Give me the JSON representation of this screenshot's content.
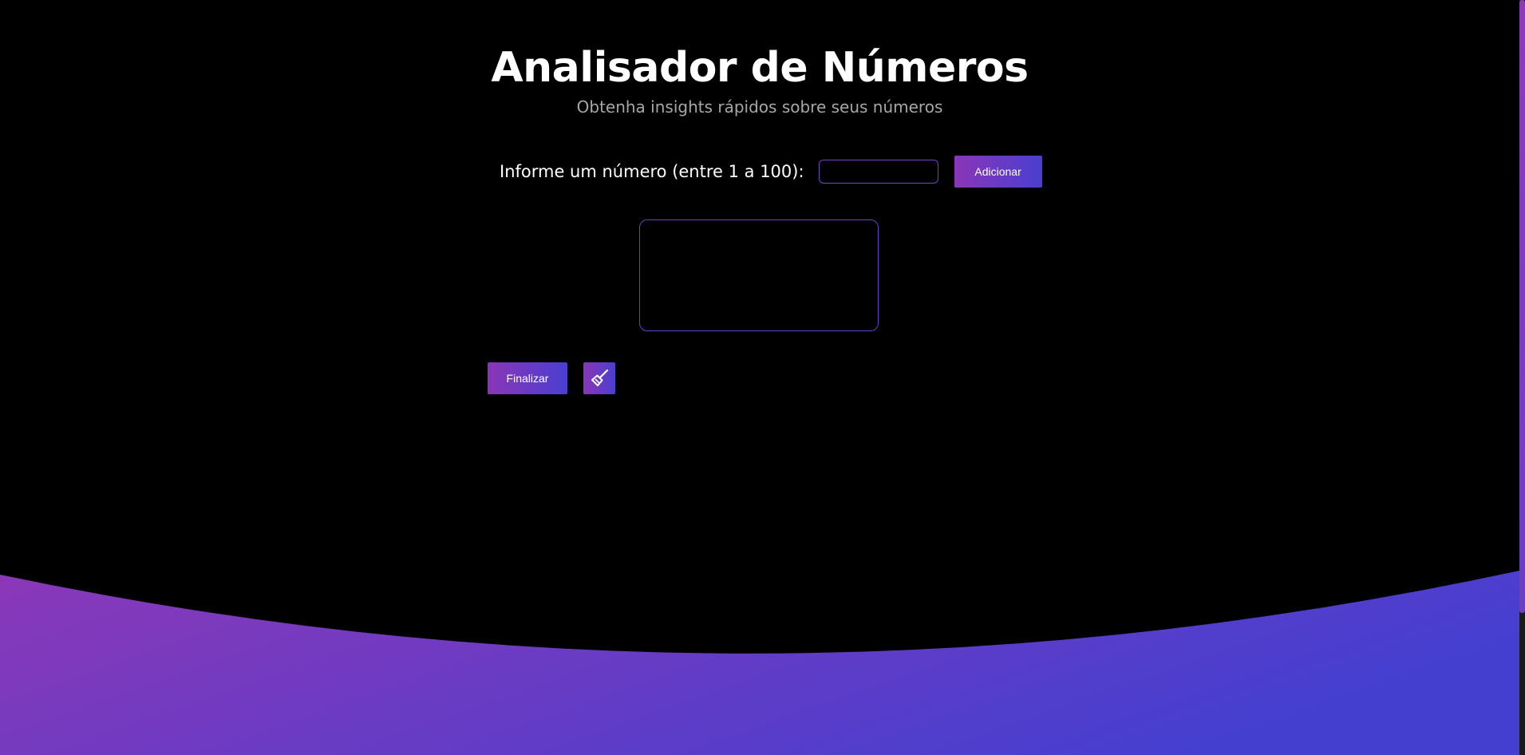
{
  "header": {
    "title": "Analisador de Números",
    "subtitle": "Obtenha insights rápidos sobre seus números"
  },
  "form": {
    "label": "Informe um número (entre 1 a 100):",
    "input_value": "",
    "add_label": "Adicionar"
  },
  "list": {
    "items": []
  },
  "actions": {
    "finish_label": "Finalizar",
    "clear_icon": "broom-icon"
  },
  "colors": {
    "background": "#000000",
    "accent_start": "#8a36b8",
    "accent_end": "#4a3fd0",
    "text": "#ffffff",
    "subtitle": "#a7a7a7"
  }
}
